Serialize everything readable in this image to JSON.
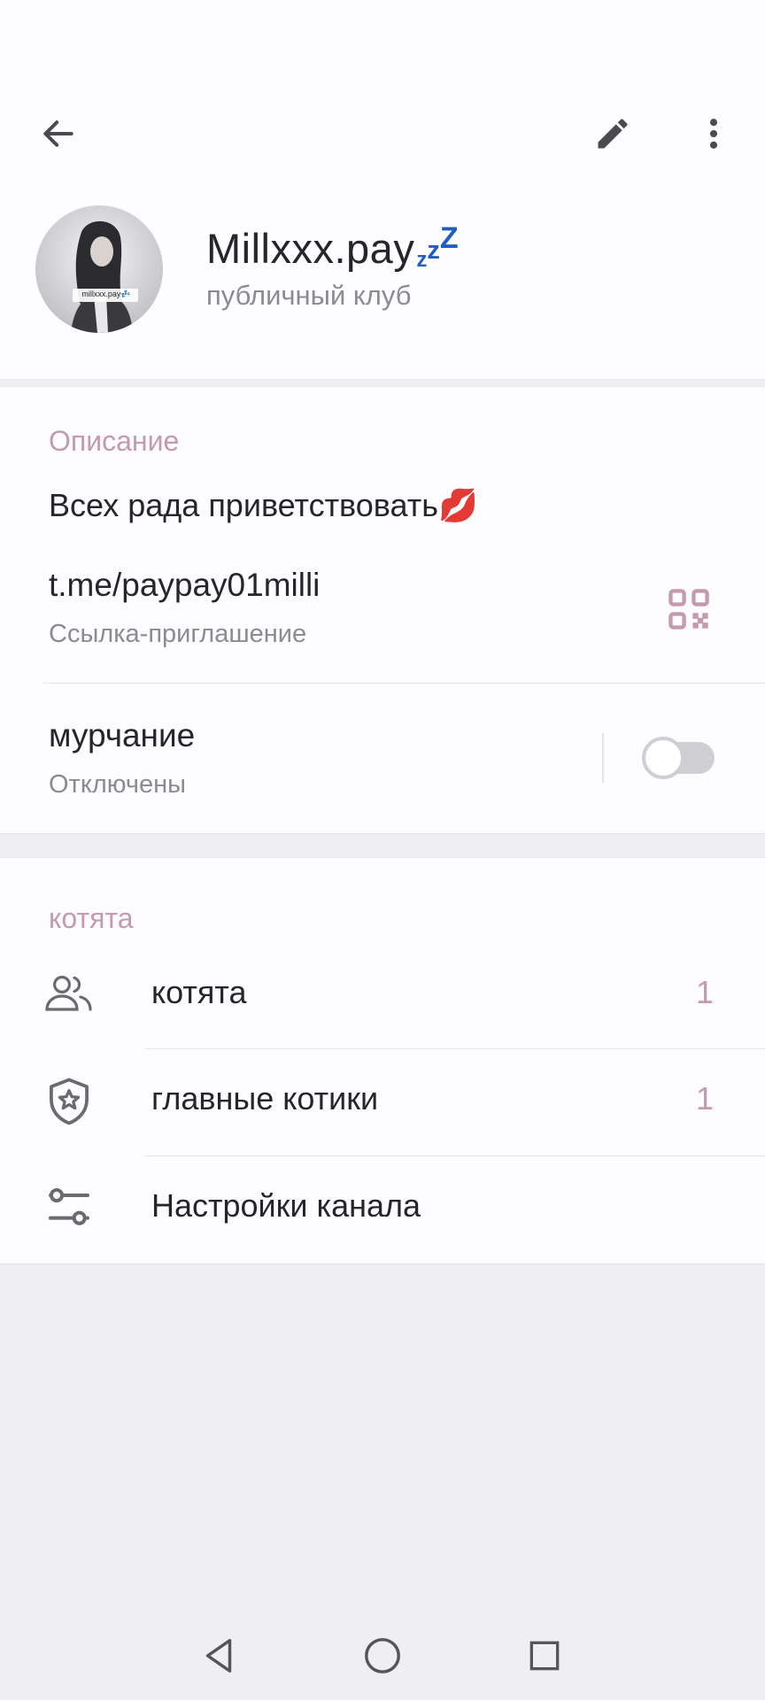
{
  "header": {
    "back_icon": "arrow-left-icon",
    "edit_icon": "pencil-icon",
    "more_icon": "more-vertical-icon"
  },
  "profile": {
    "name": "Millxxx.pay",
    "name_suffix": [
      "z",
      "z",
      "Z"
    ],
    "status": "публичный клуб",
    "avatar_caption": "millxxx.pay💤"
  },
  "info": {
    "section_title": "Описание",
    "description": "Всех рада приветствовать💋",
    "link": "t.me/paypay01milli",
    "link_caption": "Ссылка-приглашение",
    "qr_icon": "qr-code-icon",
    "notifications_label": "мурчание",
    "notifications_status": "Отключены",
    "notifications_enabled": false
  },
  "members": {
    "section_title": "котята",
    "rows": [
      {
        "icon": "users-icon",
        "label": "котята",
        "count": "1"
      },
      {
        "icon": "shield-star-icon",
        "label": "главные котики",
        "count": "1"
      },
      {
        "icon": "sliders-icon",
        "label": "Настройки канала",
        "count": ""
      }
    ]
  },
  "system_nav": {
    "back_icon": "triangle-back-icon",
    "home_icon": "circle-home-icon",
    "recents_icon": "square-recents-icon"
  },
  "colors": {
    "accent": "#c49aac",
    "text": "#262629",
    "secondary_text": "#8c8a92",
    "background": "#efeef2",
    "card": "#fdfcfe",
    "zzz": "#1f5fc2"
  }
}
